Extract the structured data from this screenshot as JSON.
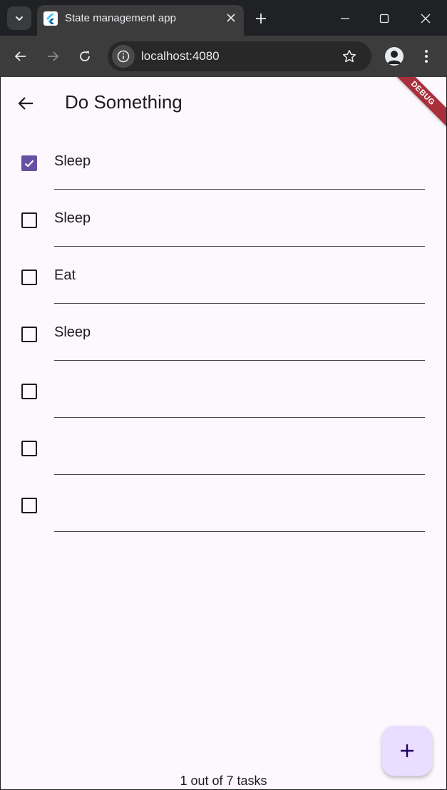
{
  "browser": {
    "tab_title": "State management app",
    "url": "localhost:4080"
  },
  "app": {
    "title": "Do Something",
    "debug_banner": "DEBUG",
    "tasks": [
      {
        "text": "Sleep",
        "done": true
      },
      {
        "text": "Sleep",
        "done": false
      },
      {
        "text": "Eat",
        "done": false
      },
      {
        "text": "Sleep",
        "done": false
      },
      {
        "text": "",
        "done": false
      },
      {
        "text": "",
        "done": false
      },
      {
        "text": "",
        "done": false
      }
    ],
    "footer": "1 out of 7 tasks"
  },
  "colors": {
    "accent": "#6750a4",
    "background": "#fdf7fe",
    "fab": "#ebddff",
    "debug": "#a8303a"
  },
  "icons": {
    "tab_search": "chevron-down-icon",
    "favicon": "flutter-icon",
    "back": "arrow-left-icon",
    "add": "plus-icon"
  }
}
